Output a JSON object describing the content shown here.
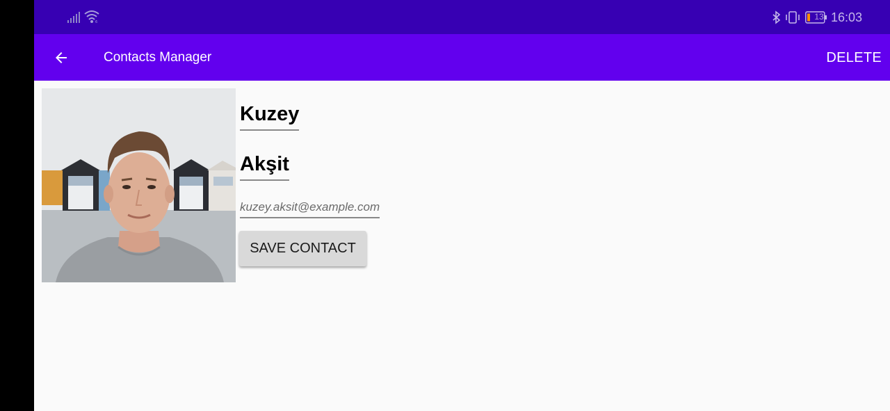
{
  "status_bar": {
    "time": "16:03",
    "battery_level": "13",
    "icons": [
      "signal-icon",
      "wifi-icon",
      "bluetooth-icon",
      "vibrate-icon",
      "battery-icon"
    ]
  },
  "app_bar": {
    "title": "Contacts Manager",
    "back_icon": "arrow-back-icon",
    "delete_label": "DELETE"
  },
  "contact": {
    "first_name": "Kuzey",
    "last_name": "Akşit",
    "email": "kuzey.aksit@example.com",
    "save_label": "SAVE CONTACT"
  },
  "colors": {
    "status_bar": "#3700b3",
    "app_bar": "#6200ee",
    "background": "#fafafa",
    "button": "#d9d9d9"
  }
}
